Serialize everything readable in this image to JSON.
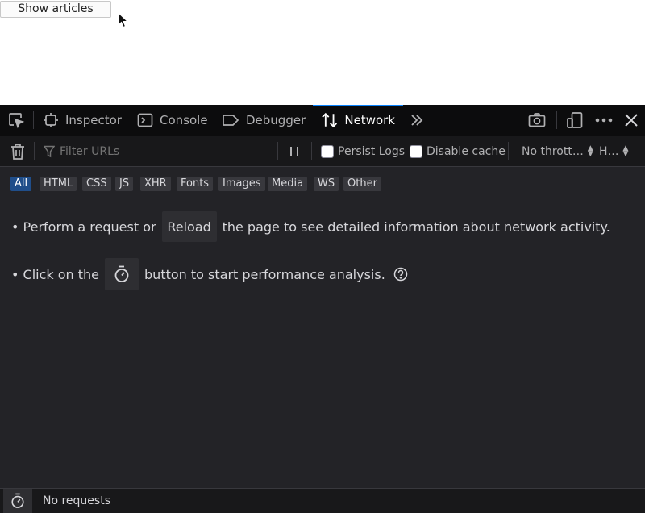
{
  "page": {
    "show_articles_label": "Show articles"
  },
  "toolbar": {
    "tabs": [
      {
        "label": "Inspector"
      },
      {
        "label": "Console"
      },
      {
        "label": "Debugger"
      },
      {
        "label": "Network"
      }
    ],
    "selected_tab": "Network",
    "accent_color": "#0a84ff"
  },
  "filterbar": {
    "filter_placeholder": "Filter URLs",
    "persist_logs_label": "Persist Logs",
    "disable_cache_label": "Disable cache",
    "throttling_label": "No thrott…",
    "har_label": "H…"
  },
  "type_filters": {
    "items": [
      "All",
      "HTML",
      "CSS",
      "JS",
      "XHR",
      "Fonts",
      "Images",
      "Media",
      "WS",
      "Other"
    ],
    "active": "All"
  },
  "content": {
    "line1_prefix": "• Perform a request or",
    "reload_label": "Reload",
    "line1_suffix": "the page to see detailed information about network activity.",
    "line2_prefix": "• Click on the",
    "line2_suffix": "button to start performance analysis."
  },
  "statusbar": {
    "text": "No requests"
  },
  "icons": {
    "pick": "element-picker-icon",
    "inspector": "inspector-icon",
    "console": "console-icon",
    "debugger": "debugger-icon",
    "network": "network-arrows-icon",
    "overflow": "chevron-double-right-icon",
    "screenshot": "camera-icon",
    "responsive": "responsive-design-icon",
    "meatball": "more-options-icon",
    "close": "close-icon",
    "trash": "trash-icon",
    "filter": "filter-icon",
    "pause": "pause-icon",
    "stopwatch": "stopwatch-icon",
    "help": "help-icon"
  }
}
